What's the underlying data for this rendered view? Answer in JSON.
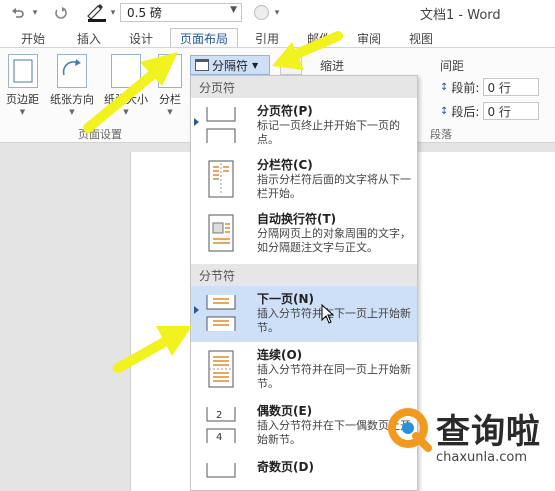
{
  "title_bar": {
    "undo_icon": "undo-icon",
    "redo_icon": "redo-icon",
    "pen_icon": "pen-icon",
    "line_weight": "0.5 磅",
    "document_title": "文档1 - Word"
  },
  "tabs": [
    "开始",
    "插入",
    "设计",
    "页面布局",
    "引用",
    "邮件",
    "审阅",
    "视图"
  ],
  "active_tab": "页面布局",
  "ribbon": {
    "margins_label": "页边距",
    "orientation_label": "纸张方向",
    "size_label": "纸张大小",
    "columns_label": "分栏",
    "breaks_button": "分隔符",
    "page_setup_group": "页面设置",
    "indent_label": "缩进",
    "spacing_label": "间距",
    "before_label": "段前:",
    "before_value": "0 行",
    "after_label": "段后:",
    "after_value": "0 行",
    "paragraph_group": "段落"
  },
  "menu": {
    "page_breaks_header": "分页符",
    "section_breaks_header": "分节符",
    "items": [
      {
        "title": "分页符(P)",
        "desc": "标记一页终止并开始下一页的点。",
        "icon": "page-break-icon"
      },
      {
        "title": "分栏符(C)",
        "desc": "指示分栏符后面的文字将从下一栏开始。",
        "icon": "column-break-icon"
      },
      {
        "title": "自动换行符(T)",
        "desc": "分隔网页上的对象周围的文字，如分隔题注文字与正文。",
        "icon": "text-wrapping-icon"
      },
      {
        "title": "下一页(N)",
        "desc": "插入分节符并在下一页上开始新节。",
        "icon": "next-page-icon"
      },
      {
        "title": "连续(O)",
        "desc": "插入分节符并在同一页上开始新节。",
        "icon": "continuous-icon"
      },
      {
        "title": "偶数页(E)",
        "desc": "插入分节符并在下一偶数页上开始新节。",
        "icon": "even-page-icon"
      },
      {
        "title": "奇数页(D)",
        "desc": "",
        "icon": "odd-page-icon"
      }
    ]
  },
  "watermark": {
    "cn": "查询啦",
    "en": "chaxunla.com"
  },
  "colors": {
    "accent": "#2b579a",
    "hover": "#cde0f7",
    "arrow": "#f2f21f"
  }
}
